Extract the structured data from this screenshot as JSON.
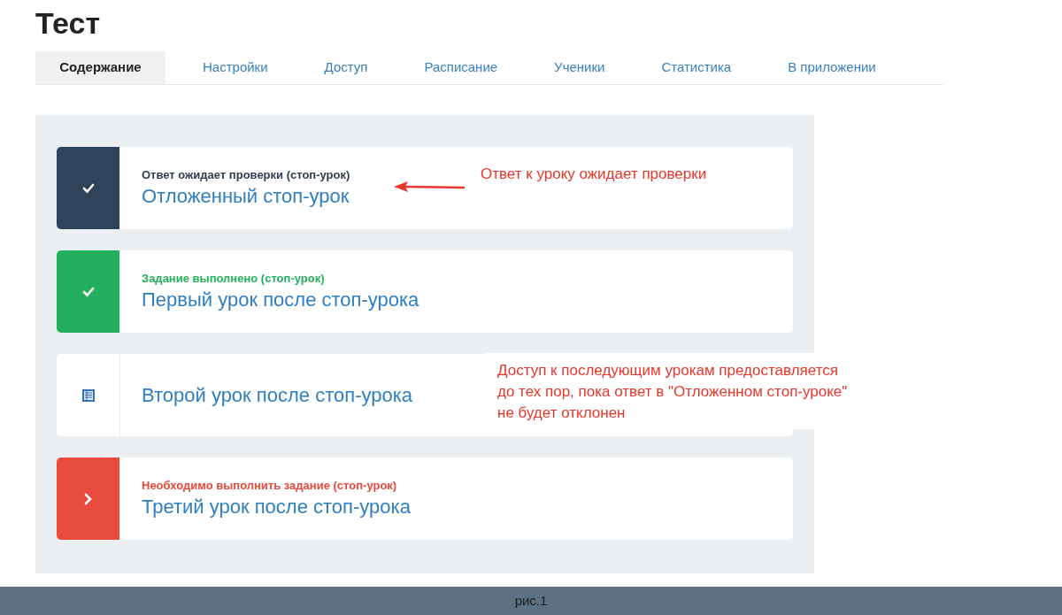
{
  "title": "Тест",
  "tabs": [
    {
      "label": "Содержание",
      "selected": true
    },
    {
      "label": "Настройки",
      "selected": false
    },
    {
      "label": "Доступ",
      "selected": false
    },
    {
      "label": "Расписание",
      "selected": false
    },
    {
      "label": "Ученики",
      "selected": false
    },
    {
      "label": "Статистика",
      "selected": false
    },
    {
      "label": "В приложении",
      "selected": false
    }
  ],
  "lessons": [
    {
      "kind": "pending",
      "status": "Ответ ожидает проверки (стоп-урок)",
      "title": "Отложенный стоп-урок"
    },
    {
      "kind": "done",
      "status": "Задание выполнено (стоп-урок)",
      "title": "Первый урок после стоп-урока"
    },
    {
      "kind": "open",
      "title": "Второй урок после стоп-урока"
    },
    {
      "kind": "required",
      "status": "Необходимо выполнить задание (стоп-урок)",
      "title": "Третий урок после стоп-урока"
    }
  ],
  "annotations": [
    {
      "kind": "arrow",
      "text": "Ответ к уроку ожидает проверки"
    },
    {
      "kind": "box",
      "text": "Доступ к последующим урокам предоставляется\nдо тех пор, пока ответ в \"Отложенном стоп-уроке\"\nне будет отклонен"
    }
  ],
  "caption": "рис.1"
}
